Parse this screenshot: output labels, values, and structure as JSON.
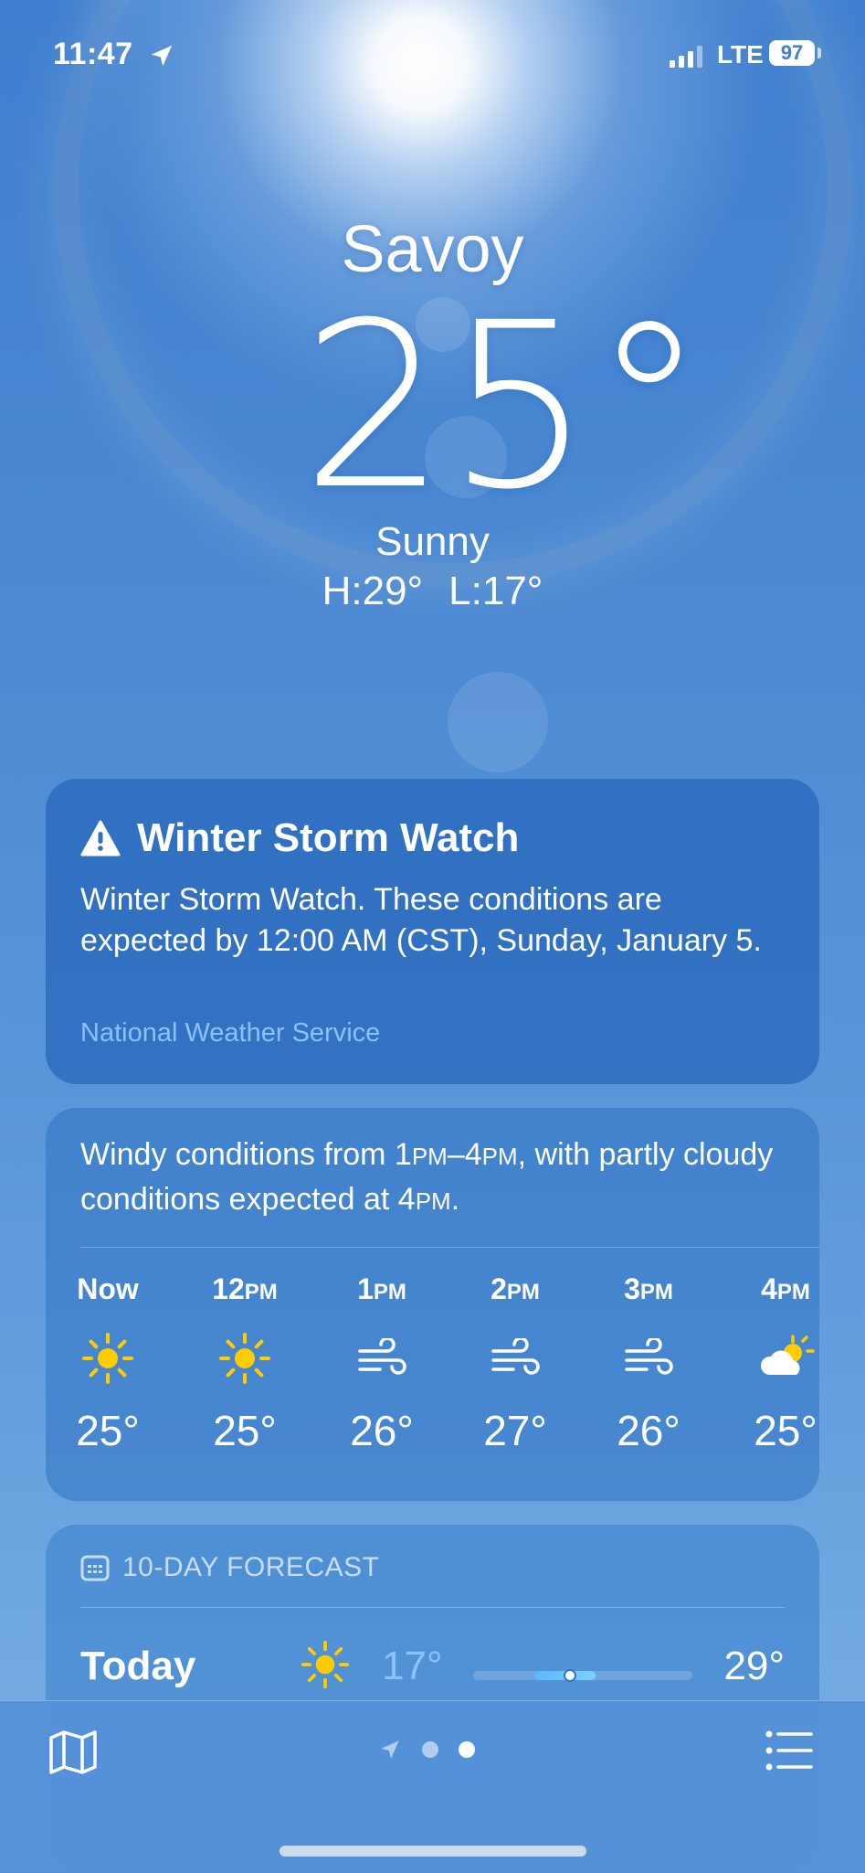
{
  "status_bar": {
    "time": "11:47",
    "network": "LTE",
    "battery": "97"
  },
  "header": {
    "city": "Savoy",
    "temperature": "25°",
    "condition": "Sunny",
    "high": "H:29°",
    "low": "L:17°"
  },
  "alert": {
    "title": "Winter Storm Watch",
    "text": "Winter Storm Watch. These conditions are expected by 12:00 AM (CST), Sunday, January 5.",
    "source": "National Weather Service",
    "icon": "warning-triangle-icon"
  },
  "hourly": {
    "summary_parts": [
      "Windy conditions from 1",
      "PM",
      "–4",
      "PM",
      ", with partly cloudy conditions expected at 4",
      "PM",
      "."
    ],
    "hours": [
      {
        "label": "Now",
        "suffix": "",
        "icon": "sun-icon",
        "temp": "25°"
      },
      {
        "label": "12",
        "suffix": "PM",
        "icon": "sun-icon",
        "temp": "25°"
      },
      {
        "label": "1",
        "suffix": "PM",
        "icon": "wind-icon",
        "temp": "26°"
      },
      {
        "label": "2",
        "suffix": "PM",
        "icon": "wind-icon",
        "temp": "27°"
      },
      {
        "label": "3",
        "suffix": "PM",
        "icon": "wind-icon",
        "temp": "26°"
      },
      {
        "label": "4",
        "suffix": "PM",
        "icon": "partly-cloudy-icon",
        "temp": "25°"
      }
    ]
  },
  "forecast": {
    "header": "10-DAY FORECAST",
    "days": [
      {
        "day": "Today",
        "icon": "sun-icon",
        "low": "17°",
        "high": "29°",
        "range_start": 0.28,
        "range_end": 0.56,
        "current": 0.44
      }
    ]
  },
  "bottom_bar": {
    "map_icon": "map-icon",
    "location_icon": "location-arrow-icon",
    "list_icon": "list-icon",
    "pages": 2,
    "active_page": 2
  },
  "colors": {
    "sun_yellow": "#ffcc00",
    "low_temp_blue": "#8cc0ff"
  }
}
